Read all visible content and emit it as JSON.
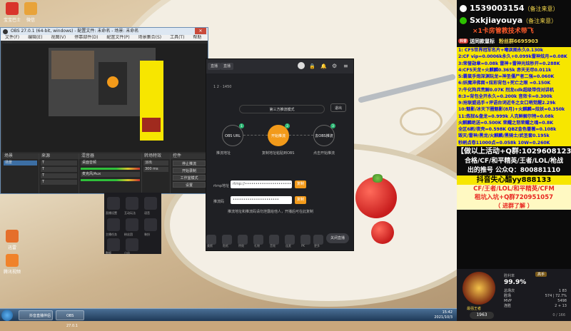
{
  "desktop": {
    "icons": [
      {
        "label": "宝宝巴士",
        "color": "#d9342b"
      },
      {
        "label": "微信",
        "color": "#e8a33a"
      },
      {
        "label": "迅雷",
        "color": "#e56f2b"
      },
      {
        "label": "腾讯视频",
        "color": "#f0822a"
      }
    ]
  },
  "obs": {
    "title": "OBS 27.0.1 (64-bit, windows) - 配置文件: 未命名 - 场景: 未命名",
    "menu": [
      "文件(F)",
      "编辑(E)",
      "视图(V)",
      "停靠部件(D)",
      "配置文件(P)",
      "场景集合(S)",
      "工具(T)",
      "帮助(H)"
    ],
    "panels": {
      "scenes": "场景",
      "sources": "来源",
      "mixer": "混音器",
      "transitions": "转场特效",
      "controls": "控件"
    },
    "scene_items": [
      "场景"
    ],
    "source_items": [
      "T",
      "T",
      "T",
      "T",
      "T"
    ],
    "mixer_items": [
      "桌面音频",
      "麦克风/Aux"
    ],
    "transition_values": [
      "淡出",
      "300 ms"
    ],
    "control_buttons": [
      "停止推流",
      "开始录制",
      "工作室模式",
      "设置",
      "退出"
    ],
    "status": "LIVE: 00:00:00  REC: 00:00:00  CPU: 2.1%, 60.00 fps"
  },
  "stream_app": {
    "tabs": [
      "直播",
      "直播"
    ],
    "sub": "1 2  · 1450",
    "mode_box": "第三方推流模式",
    "right_btn": "退出",
    "steps": [
      {
        "badge": "1",
        "label": "OBS URL",
        "caption": "推流地址"
      },
      {
        "badge": "2",
        "label": "开始推流",
        "caption": "复制地址粘贴到OBS"
      },
      {
        "badge": "3",
        "label": "去OBS推流",
        "caption": "点击开始推流"
      }
    ],
    "url_label": "rtmp地址",
    "url_value": "rtmp://••••••••••••••••••••••",
    "key_label": "推流码",
    "key_value": "••••••••••••••••••••••",
    "copy_label": "复制",
    "hint": "推流地址和推流码请勿泄露给他人，开播后可在此复制",
    "tools": [
      "美颜",
      "贴纸",
      "特效",
      "礼物",
      "音效",
      "连麦",
      "PK",
      "更多"
    ],
    "end_btn": "关闭直播"
  },
  "dock": {
    "items": [
      "直播设置",
      "互动玩法",
      "语音",
      "主播任务",
      "粉丝团",
      "装扮",
      "数据",
      "小店"
    ]
  },
  "taskbar": {
    "tasks": [
      "抖音直播伴侣",
      "OBS 27.0.1"
    ],
    "time": "15:42",
    "date": "2021/10/3"
  },
  "side": {
    "contacts": [
      {
        "icon": "qq-icon",
        "text": "1539003154",
        "tag": "（备注来意）"
      },
      {
        "icon": "wechat-icon",
        "text": "Sxkjiayouya",
        "tag": "（备注来意）"
      }
    ],
    "tagline": "×1卡房管教技术带飞",
    "promo": {
      "pill": "抖音",
      "left": "送同款鼠标",
      "right": "粉丝群6695903"
    },
    "price_list": [
      "1: CF5世界冠军名片+嘲讽图永久0.130k",
      "2:CF vip=0.0006k永久+0.099k雷神炫月=0.08K",
      "3:荣誉勋章=0.08k 雷神+雷神光炫秒开=0.288K",
      "4:CF5天龙+火麒麟0.365k 赤天无尽0.011k",
      "5:霸鼠手炮深渊玩龙=神圣僵尸者二强=0.060K",
      "6:妖魔淬佛面+炫彩背包+死亡之眼 =0.150K",
      "7:牛化狗兵荒解0.07K 烈龙cdk超级带伐对讲机",
      "8:3=背包全开永久=0.200k       音效卡=0.300k",
      "9:抢联盟选手+评语台词近冬之女口哨觉醒2.29k",
      "10:魅影/冰天下圈魅影(8月)+火麒麟=炫妖=0.350k",
      "11:炼狱&盘龙=0.999k  人克鲜解尔特=0.08k",
      "火麒麟绝送=0.500K 荣耀之怒荣耀之魂=0.8K",
      "全区6刷/夜壳=0.598K  QBZ金色蔷薇=0.108k",
      "毁灭/雷神/黑龙/火麒麟/黑骑士/武圣套0.195k",
      "秒刷点卷11000点=0.058k   10W=0.260K"
    ],
    "announcements": [
      {
        "text": "【做以上活动+Q群:1029608123】",
        "color": "#ffffff"
      },
      {
        "text": "合格/CF/和平精英/王者/LOL/枪战",
        "color": "#ffffff"
      },
      {
        "text": "出的推号 公众Q：800881110",
        "color": "#ffffff"
      }
    ],
    "yellow_band": "抖音失心醋yy888133",
    "red_line1": "CF/王者/LOL/和平精英/CFM",
    "red_line2": "租坑入坑+Q群720951057",
    "red_line3": "（ 进群了解 ）",
    "card": {
      "rank": "最强王者",
      "winrate": "99.9%",
      "winrate_label": "胜利率",
      "score": "1963",
      "badge": "高手",
      "rows": [
        {
          "k": "总场次",
          "v": "1 83"
        },
        {
          "k": "胜场",
          "v": "574 | 72.7%"
        },
        {
          "k": "MVP",
          "v": "5498"
        },
        {
          "k": "连胜",
          "v": "2 + 13"
        }
      ],
      "footer": "0 / 166"
    }
  }
}
